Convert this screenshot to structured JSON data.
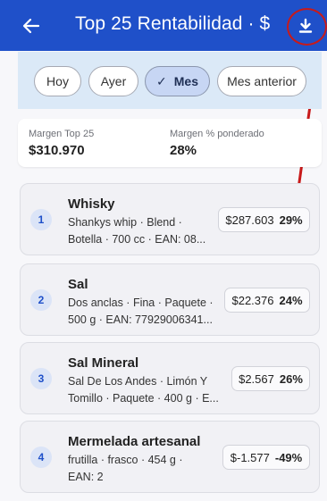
{
  "appbar": {
    "title": "Top 25 Rentabilidad · $",
    "back_icon": "arrow-left",
    "download_icon": "download",
    "bg_color": "#1f50c9"
  },
  "annotation_color": "#c81a1a",
  "filters": [
    {
      "label": "Hoy",
      "selected": false
    },
    {
      "label": "Ayer",
      "selected": false
    },
    {
      "label": "Mes",
      "selected": true,
      "check": "✓"
    },
    {
      "label": "Mes anterior",
      "selected": false
    }
  ],
  "summary": {
    "margin_top_label": "Margen Top 25",
    "margin_top_value": "$310.970",
    "margin_pct_label": "Margen % ponderado",
    "margin_pct_value": "28%"
  },
  "products": [
    {
      "rank": "1",
      "name": "Whisky",
      "desc_line1": "Shankys whip · Blend ·",
      "desc_line2": "Botella · 700 cc · EAN: 08...",
      "amount": "$287.603",
      "percent": "29%"
    },
    {
      "rank": "2",
      "name": "Sal",
      "desc_line1": "Dos anclas · Fina · Paquete ·",
      "desc_line2": "500 g · EAN: 77929006341...",
      "amount": "$22.376",
      "percent": "24%"
    },
    {
      "rank": "3",
      "name": "Sal Mineral",
      "desc_line1": "Sal De Los Andes · Limón Y",
      "desc_line2": "Tomillo · Paquete · 400 g · E...",
      "amount": "$2.567",
      "percent": "26%"
    },
    {
      "rank": "4",
      "name": "Mermelada artesanal",
      "desc_line1": "frutilla · frasco · 454 g ·",
      "desc_line2": "EAN: 2",
      "amount": "$-1.577",
      "percent": "-49%"
    }
  ]
}
